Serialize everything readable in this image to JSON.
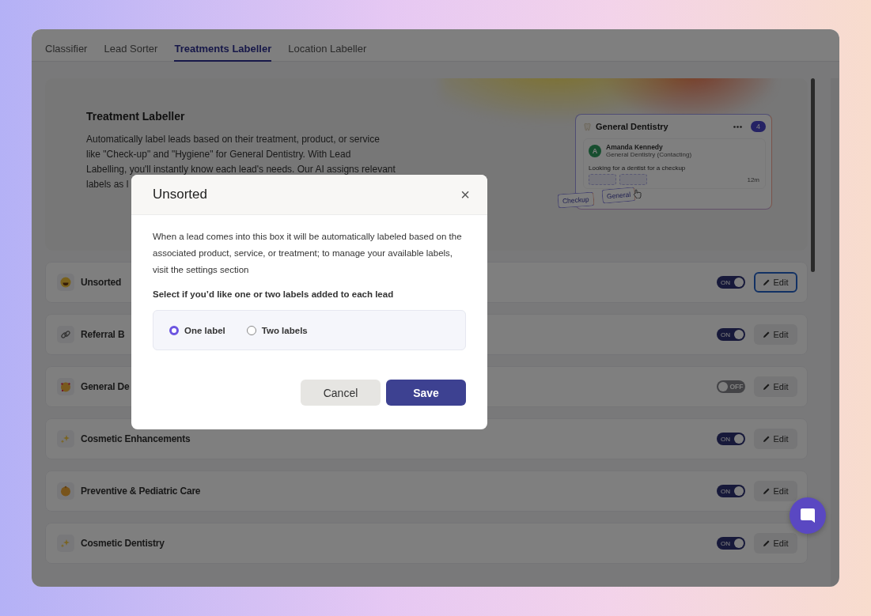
{
  "tabs": [
    {
      "label": "Classifier",
      "selected": false
    },
    {
      "label": "Lead Sorter",
      "selected": false
    },
    {
      "label": "Treatments Labeller",
      "selected": true
    },
    {
      "label": "Location Labeller",
      "selected": false
    }
  ],
  "hero": {
    "title": "Treatment Labeller",
    "description": "Automatically label leads based on their treatment, product, or service\nlike \"Check-up\" and \"Hygiene\" for General Dentistry. With Lead\nLabelling, you'll instantly know each lead's needs. Our AI assigns relevant\nlabels as l",
    "preview": {
      "title": "General Dentistry",
      "count": "4",
      "avatar_initial": "A",
      "lead_name": "Amanda Kennedy",
      "lead_subtitle": "General Dentistry (Contacting)",
      "note": "Looking for a dentist for a checkup",
      "time": "12m",
      "tags": [
        "Checkup",
        "General"
      ]
    }
  },
  "rows": [
    {
      "name": "Unsorted",
      "on": true,
      "toggle_label": "ON",
      "edit": "Edit",
      "focused": true
    },
    {
      "name": "Referral B",
      "on": true,
      "toggle_label": "ON",
      "edit": "Edit",
      "focused": false
    },
    {
      "name": "General De",
      "on": false,
      "toggle_label": "OFF",
      "edit": "Edit",
      "focused": false
    },
    {
      "name": "Cosmetic Enhancements",
      "on": true,
      "toggle_label": "ON",
      "edit": "Edit",
      "focused": false
    },
    {
      "name": "Preventive & Pediatric Care",
      "on": true,
      "toggle_label": "ON",
      "edit": "Edit",
      "focused": false
    },
    {
      "name": "Cosmetic Dentistry",
      "on": true,
      "toggle_label": "ON",
      "edit": "Edit",
      "focused": false
    }
  ],
  "modal": {
    "title": "Unsorted",
    "close": "×",
    "body": "When a lead comes into this box it will be automatically labeled based on the associated product, service, or treatment; to manage your available labels, visit the settings section",
    "question": "Select if you’d like one or two labels added to each lead",
    "options": [
      {
        "label": "One label",
        "selected": true
      },
      {
        "label": "Two labels",
        "selected": false
      }
    ],
    "cancel": "Cancel",
    "save": "Save"
  }
}
